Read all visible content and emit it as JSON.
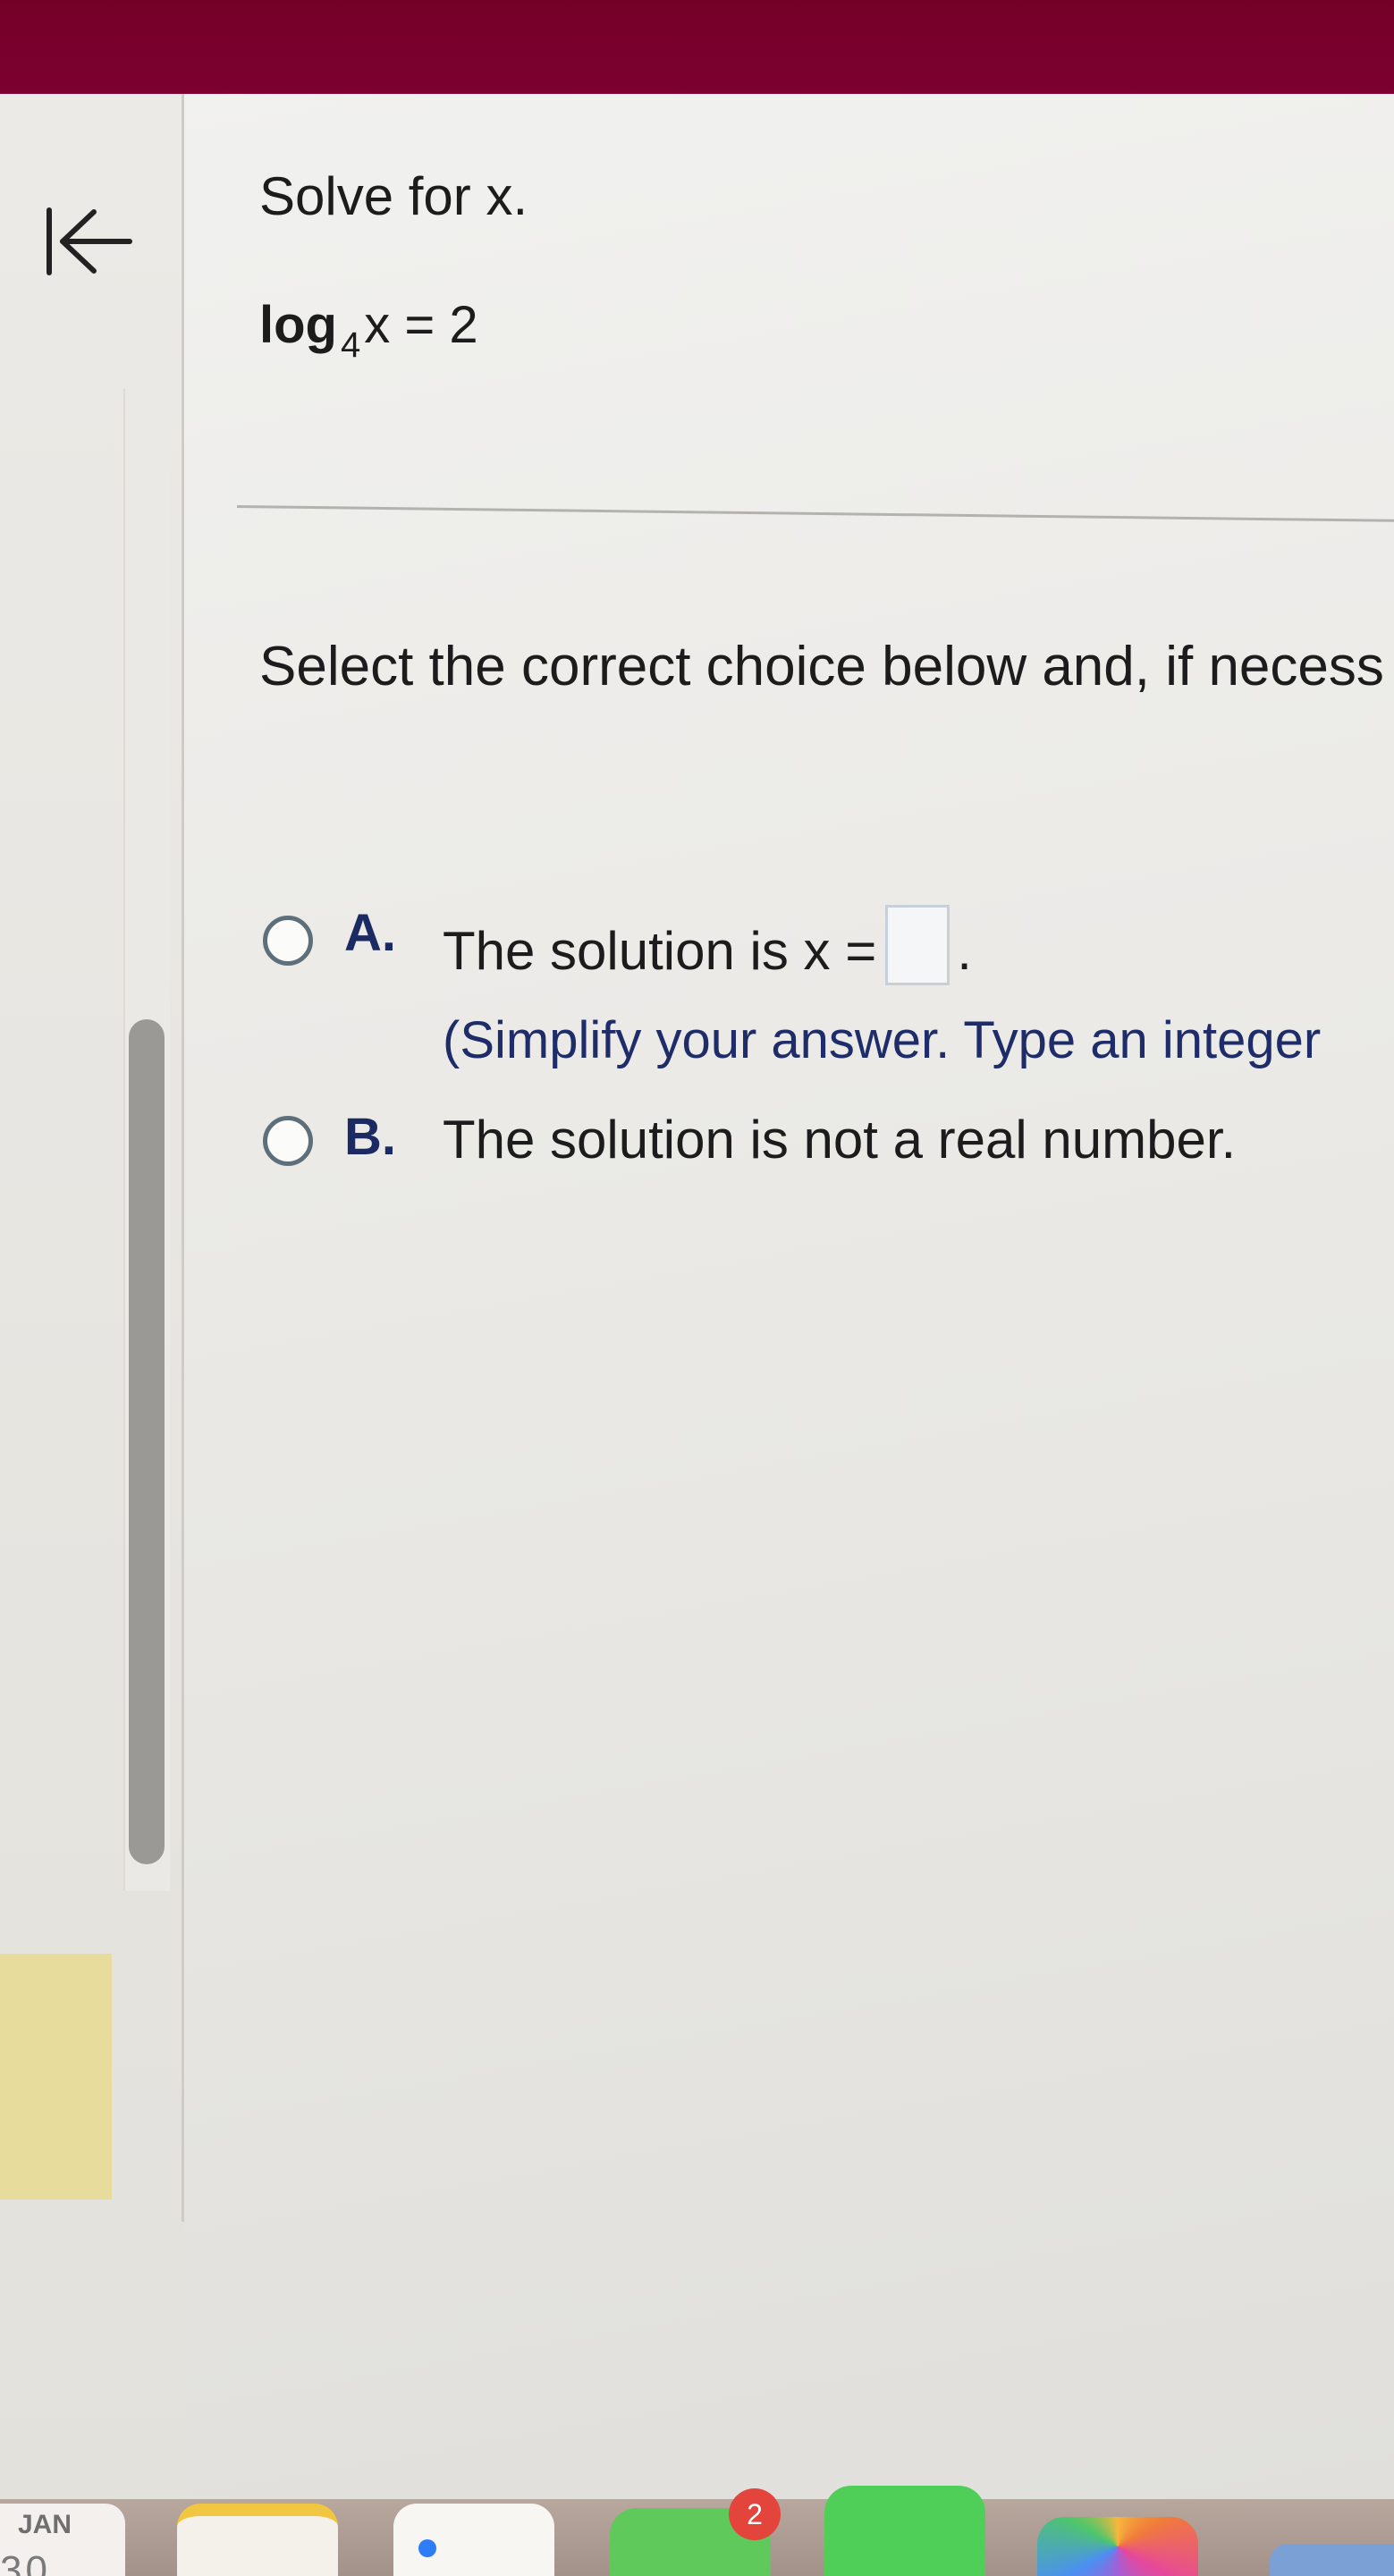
{
  "nav": {
    "back_icon": "arrow-left-to-bar-icon"
  },
  "question": {
    "heading": "Solve for x.",
    "equation_fn": "log",
    "equation_base": "4",
    "equation_rest": "x = 2"
  },
  "instruction": {
    "text": "Select the correct choice below and, if necess"
  },
  "choices": [
    {
      "letter": "A.",
      "text_before": "The solution is x =",
      "text_after": ".",
      "answer_value": "",
      "hint": "(Simplify your answer. Type an integer"
    },
    {
      "letter": "B.",
      "text": "The solution is not a real number."
    }
  ],
  "dock": {
    "calendar_month": "JAN",
    "calendar_day": "30",
    "messages_badge": "2"
  },
  "colors": {
    "frame": "#740027",
    "choice_letter": "#1c2a63",
    "hint_text": "#1e2c6a",
    "radio_border": "#5e6f7c"
  }
}
